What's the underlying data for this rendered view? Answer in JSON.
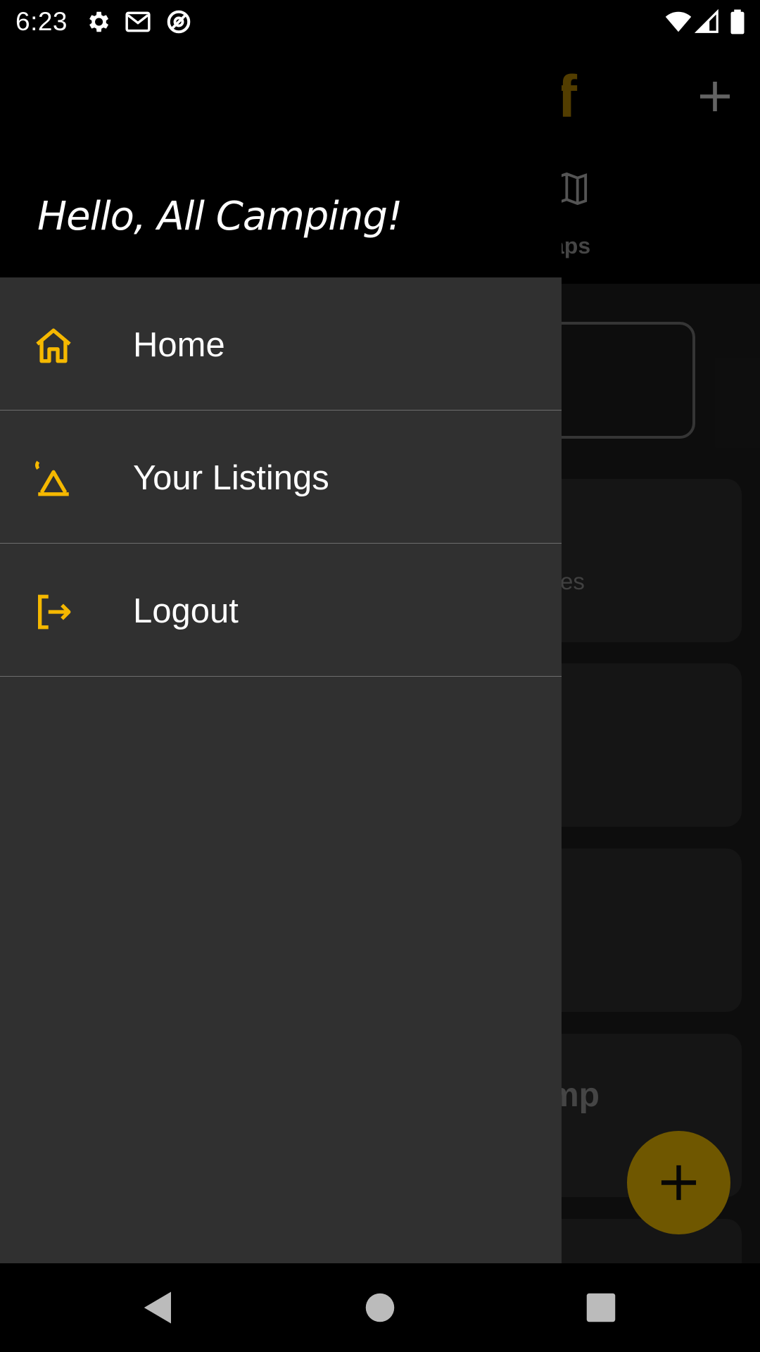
{
  "status_bar": {
    "time": "6:23",
    "icons": [
      "gear-icon",
      "gmail-icon",
      "data-saver-icon",
      "wifi-icon",
      "signal-icon",
      "battery-icon"
    ]
  },
  "background_app": {
    "logo": "f",
    "tab_label": "aps",
    "card_texts": [
      "es",
      "mp"
    ],
    "accent_color": "#f5c000"
  },
  "drawer": {
    "greeting": "Hello, All Camping!",
    "items": [
      {
        "label": "Home",
        "icon": "home-icon"
      },
      {
        "label": "Your Listings",
        "icon": "tent-icon"
      },
      {
        "label": "Logout",
        "icon": "logout-icon"
      }
    ],
    "icon_color": "#f5b800"
  },
  "nav_bar": {
    "buttons": [
      "back-icon",
      "home-circle-icon",
      "recents-icon"
    ]
  }
}
